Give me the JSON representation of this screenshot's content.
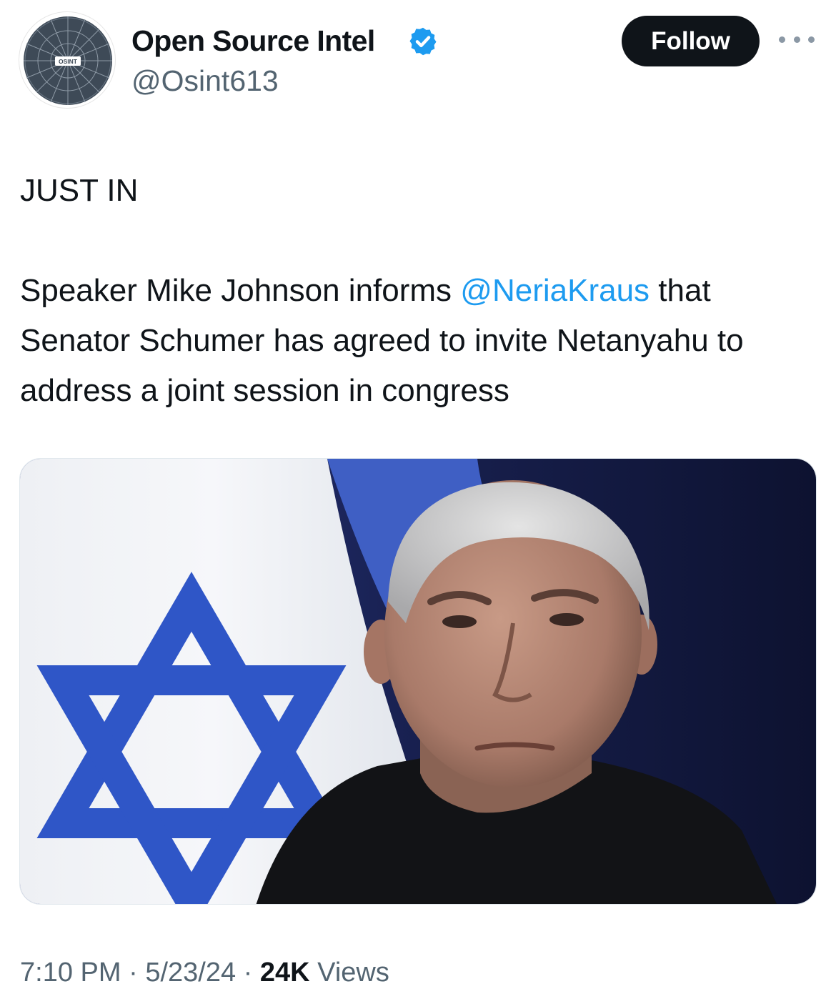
{
  "account": {
    "display_name": "Open Source Intel",
    "handle": "@Osint613",
    "verified": true,
    "avatar_text": "OSINT",
    "avatar_icon": "osint-wheel-logo"
  },
  "actions": {
    "follow_label": "Follow",
    "more_icon": "more-dots-icon"
  },
  "tweet": {
    "headline": "JUST IN",
    "body_pre": "Speaker Mike Johnson informs ",
    "mention": "@NeriaKraus",
    "body_post": " that Senator Schumer has agreed to invite Netanyahu to address a joint session in congress",
    "image_icon": "photo-netanyahu-israeli-flag"
  },
  "meta": {
    "time": "7:10 PM",
    "separator": "·",
    "date": "5/23/24",
    "views_count": "24K",
    "views_label": "Views"
  },
  "colors": {
    "text": "#0f1419",
    "secondary": "#536471",
    "link": "#1d9bf0",
    "verified": "#1d9bf0",
    "follow_bg": "#0f1419"
  }
}
